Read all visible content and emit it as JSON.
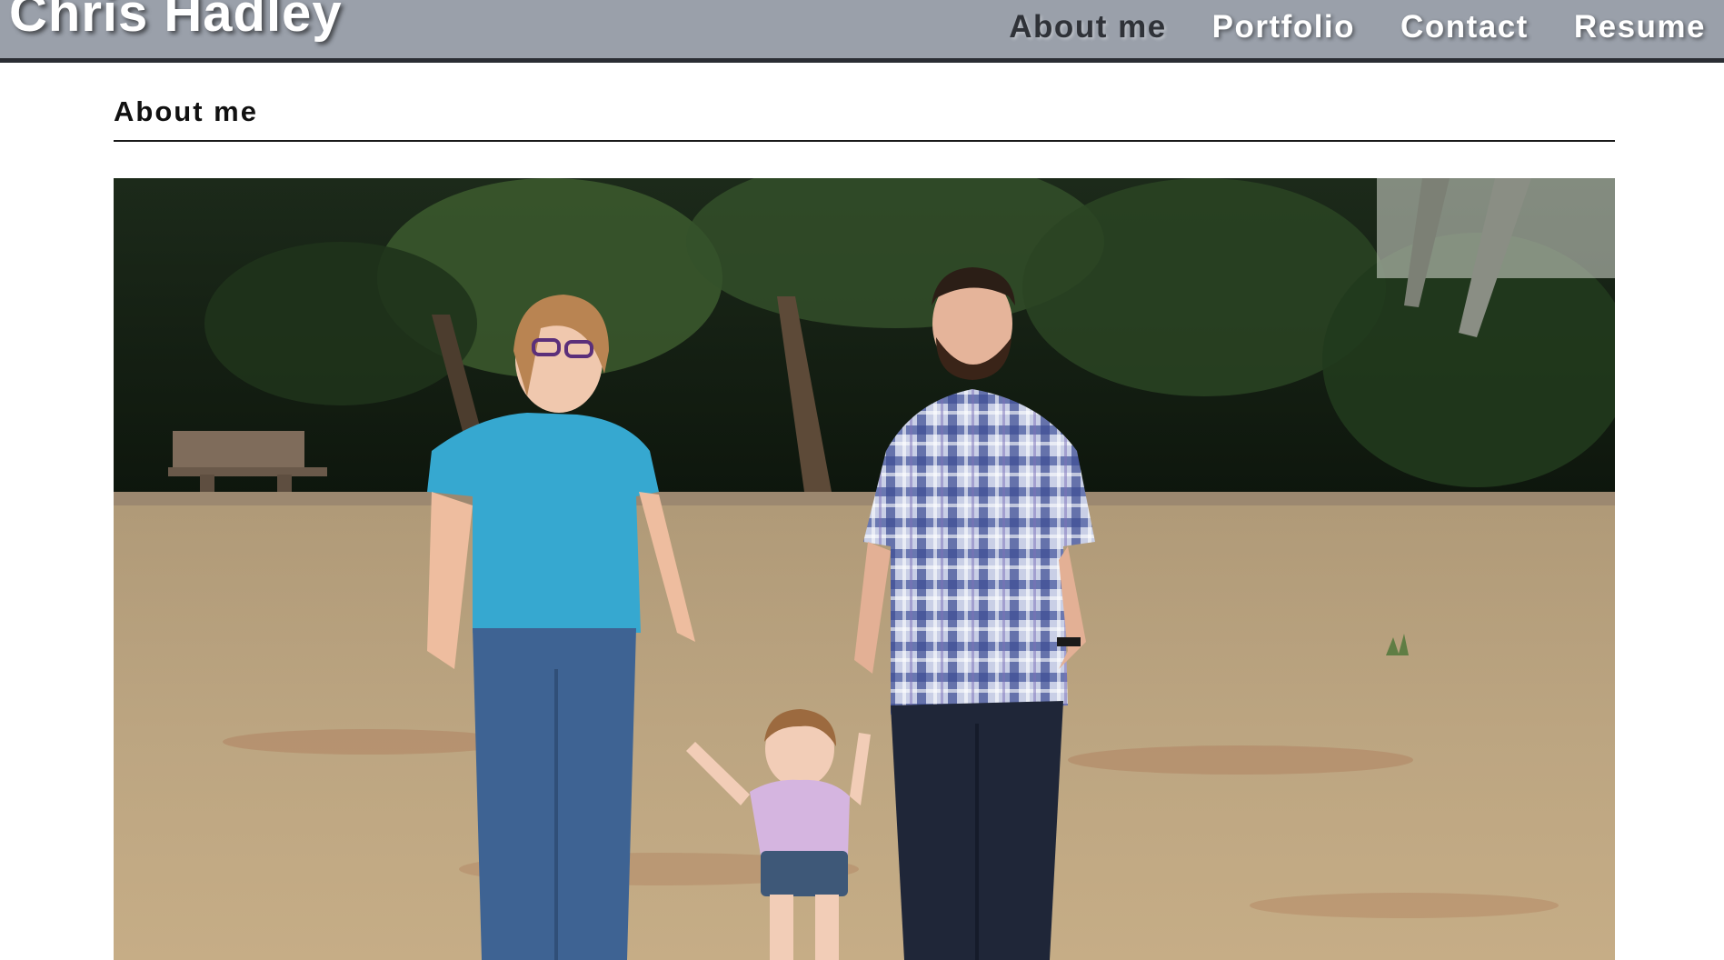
{
  "header": {
    "site_title": "Chris Hadley",
    "nav": [
      {
        "label": "About me",
        "active": true
      },
      {
        "label": "Portfolio",
        "active": false
      },
      {
        "label": "Contact",
        "active": false
      },
      {
        "label": "Resume",
        "active": false
      }
    ]
  },
  "main": {
    "section_title": "About me",
    "photo_alt": "Family photo"
  },
  "colors": {
    "header_bg": "#9aa0aa",
    "header_border": "#2a2d33",
    "nav_active": "#2f3238",
    "nav_text": "#ffffff"
  }
}
